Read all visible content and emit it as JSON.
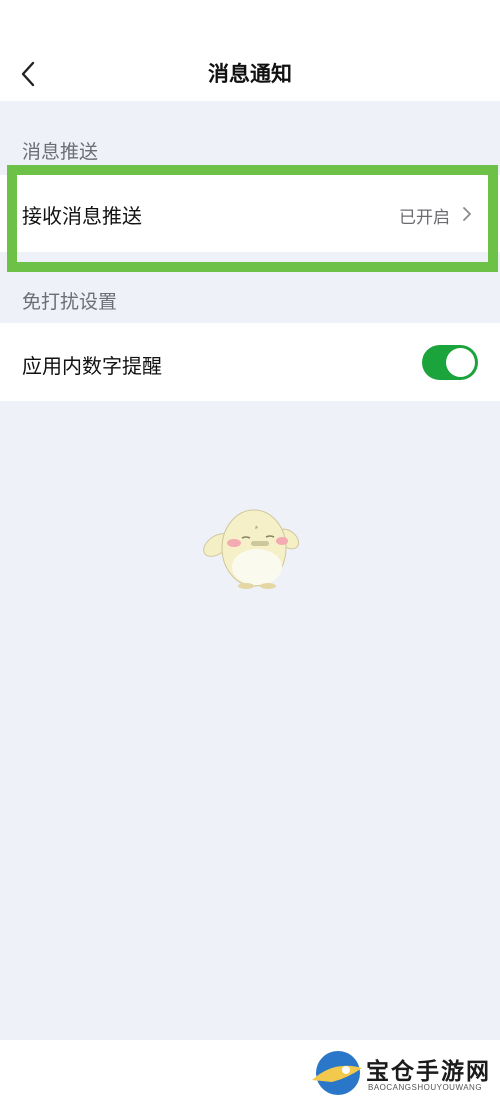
{
  "header": {
    "title": "消息通知",
    "back_icon": "chevron-left-icon"
  },
  "sections": {
    "push": {
      "label": "消息推送",
      "row": {
        "label": "接收消息推送",
        "status": "已开启",
        "icon": "chevron-right-icon"
      }
    },
    "dnd": {
      "label": "免打扰设置",
      "row": {
        "label": "应用内数字提醒",
        "toggle_on": true
      }
    }
  },
  "watermark": {
    "title": "宝仓手游网",
    "subtitle": "BAOCANGSHOUYOUWANG"
  },
  "colors": {
    "background": "#eff1f8",
    "highlight": "#6ec147",
    "toggle_on": "#1ca43c"
  }
}
